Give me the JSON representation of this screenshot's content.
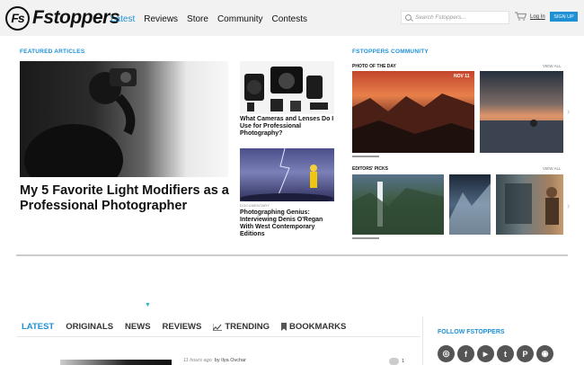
{
  "header": {
    "logo_mark": "Fs",
    "logo_text": "Fstoppers",
    "nav": [
      {
        "label": "Latest"
      },
      {
        "label": "Reviews"
      },
      {
        "label": "Store"
      },
      {
        "label": "Community"
      },
      {
        "label": "Contests"
      }
    ],
    "search_placeholder": "Search Fstoppers...",
    "login_label": "Log In",
    "signup_label": "SIGN UP",
    "accent_color": "#1e90d4"
  },
  "featured": {
    "label": "FEATURED ARTICLES",
    "main_title": "My 5 Favorite Light Modifiers as a Professional Photographer",
    "side1_title": "What Cameras and Lenses Do I Use for Professional Photography?",
    "side2_category": "DOCUMENTARY",
    "side2_title": "Photographing Genius: Interviewing Denis O'Regan With West Contemporary Editions"
  },
  "community": {
    "label": "FSTOPPERS COMMUNITY",
    "potd_label": "PHOTO OF THE DAY",
    "potd_view_all": "VIEW ALL",
    "potd_date": "NOV 11",
    "editors_label": "EDITORS' PICKS",
    "editors_view_all": "VIEW ALL",
    "next_glyph": "›"
  },
  "ad": {
    "glyph": "▼"
  },
  "tabs": [
    {
      "label": "LATEST"
    },
    {
      "label": "ORIGINALS"
    },
    {
      "label": "NEWS"
    },
    {
      "label": "REVIEWS"
    },
    {
      "label": "TRENDING"
    },
    {
      "label": "BOOKMARKS"
    }
  ],
  "follow": {
    "label": "FOLLOW FSTOPPERS",
    "networks": [
      "instagram-icon",
      "facebook-icon",
      "youtube-icon",
      "twitter-icon",
      "pinterest-icon",
      "rss-icon"
    ],
    "glyphs": [
      "◎",
      "f",
      "▶",
      "t",
      "P",
      "◉"
    ]
  },
  "feed": {
    "time": "11 hours ago",
    "by": "by",
    "author": "Ilya Ovchar",
    "comments": "1"
  }
}
